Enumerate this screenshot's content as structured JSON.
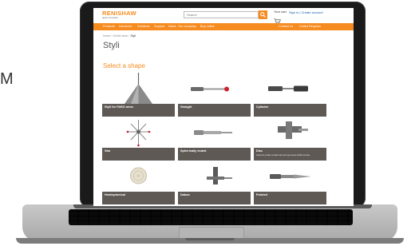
{
  "background_text": "M",
  "site": {
    "logo": "RENISHAW",
    "tagline": "apply innovation",
    "search_placeholder": "Search",
    "cart_label": "Your cart",
    "signin_text": "Sign in | Create account"
  },
  "nav": {
    "items": [
      "Products",
      "Industries",
      "Solutions",
      "Support",
      "News",
      "Our company",
      "Buy online"
    ],
    "right_items": [
      "Contact us",
      "United Kingdom"
    ]
  },
  "breadcrumb": [
    "Home",
    "Online store",
    "Styli"
  ],
  "page_title": "Styli",
  "section_title": "Select a shape",
  "cards": [
    {
      "label": "Styli for FARO arms",
      "desc": ""
    },
    {
      "label": "Straight",
      "desc": ""
    },
    {
      "label": "Cylinder",
      "desc": ""
    },
    {
      "label": "Star",
      "desc": ""
    },
    {
      "label": "Spherically ended",
      "desc": ""
    },
    {
      "label": "Disc",
      "desc": "Used to probe undercuts and grooves within bores."
    },
    {
      "label": "Hemispherical",
      "desc": ""
    },
    {
      "label": "Datum",
      "desc": ""
    },
    {
      "label": "Pointed",
      "desc": ""
    }
  ],
  "colors": {
    "brand_orange": "#f68b1f",
    "card_label_bg": "#5e5955"
  }
}
